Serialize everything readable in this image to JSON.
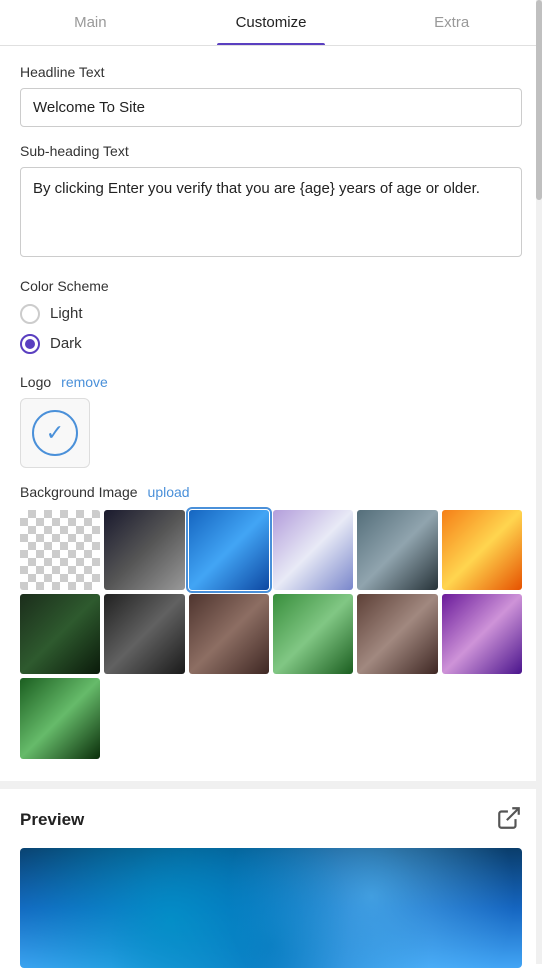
{
  "tabs": [
    {
      "id": "main",
      "label": "Main",
      "active": false
    },
    {
      "id": "customize",
      "label": "Customize",
      "active": true
    },
    {
      "id": "extra",
      "label": "Extra",
      "active": false
    }
  ],
  "headline": {
    "label": "Headline Text",
    "value": "Welcome To Site",
    "placeholder": "Enter headline text"
  },
  "subheading": {
    "label": "Sub-heading Text",
    "value": "By clicking Enter you verify that you are {age} years of age or older.",
    "placeholder": "Enter sub-heading text"
  },
  "colorScheme": {
    "label": "Color Scheme",
    "options": [
      {
        "id": "light",
        "label": "Light",
        "selected": false
      },
      {
        "id": "dark",
        "label": "Dark",
        "selected": true
      }
    ]
  },
  "logo": {
    "label": "Logo",
    "removeLabel": "remove"
  },
  "backgroundImage": {
    "label": "Background Image",
    "uploadLabel": "upload",
    "thumbnails": [
      {
        "id": "checker",
        "class": "thumb-checker",
        "selected": false
      },
      {
        "id": "tunnel",
        "class": "thumb-tunnel",
        "selected": false
      },
      {
        "id": "blue",
        "class": "thumb-blue",
        "selected": true
      },
      {
        "id": "purple-mist",
        "class": "thumb-purple-mist",
        "selected": false
      },
      {
        "id": "smoke",
        "class": "thumb-smoke",
        "selected": false
      },
      {
        "id": "sunset",
        "class": "thumb-sunset",
        "selected": false
      },
      {
        "id": "dark-plant",
        "class": "thumb-dark-plant",
        "selected": false
      },
      {
        "id": "dark-smoke",
        "class": "thumb-dark-smoke",
        "selected": false
      },
      {
        "id": "bottles",
        "class": "thumb-bottles",
        "selected": false
      },
      {
        "id": "vineyard",
        "class": "thumb-vineyard",
        "selected": false
      },
      {
        "id": "wine-glass",
        "class": "thumb-wine-glass",
        "selected": false
      },
      {
        "id": "purple-flower",
        "class": "thumb-purple-flower",
        "selected": false
      },
      {
        "id": "cannabis",
        "class": "thumb-cannabis",
        "selected": false
      }
    ]
  },
  "preview": {
    "title": "Preview"
  },
  "colors": {
    "accent": "#5a3fc0",
    "link": "#4a90d9"
  }
}
